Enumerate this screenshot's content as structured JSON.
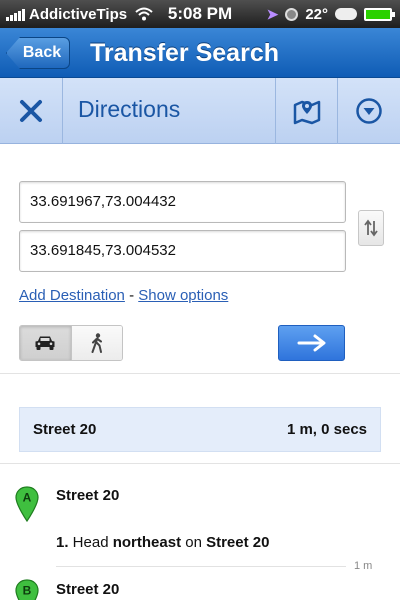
{
  "status_bar": {
    "carrier": "AddictiveTips",
    "time": "5:08 PM",
    "temperature": "22°"
  },
  "nav": {
    "back_label": "Back",
    "title": "Transfer Search"
  },
  "directions_header": {
    "title": "Directions",
    "close_icon": "close-icon",
    "map_icon": "map-pin-icon",
    "menu_icon": "chevron-down-circle-icon"
  },
  "inputs": {
    "origin_value": "33.691967,73.004432",
    "destination_value": "33.691845,73.004532"
  },
  "links": {
    "add_destination": "Add Destination",
    "separator": " - ",
    "show_options": "Show options"
  },
  "travel_mode": {
    "selected": "driving",
    "options": [
      "car-icon",
      "walk-icon"
    ]
  },
  "summary": {
    "route_name": "Street 20",
    "duration": "1 m, 0 secs"
  },
  "steps": {
    "start": {
      "marker": "A",
      "name": "Street 20"
    },
    "instruction": {
      "number": "1.",
      "prefix": " Head ",
      "direction": "northeast",
      "middle": " on ",
      "street": "Street 20"
    },
    "distance": "1 m",
    "end": {
      "marker": "B",
      "name": "Street 20"
    }
  },
  "colors": {
    "nav_blue": "#1f68bd",
    "header_bg": "#c8daf5",
    "link_blue": "#2a5fb5",
    "go_button": "#3a7fe2",
    "marker_green": "#3fbf3f"
  }
}
